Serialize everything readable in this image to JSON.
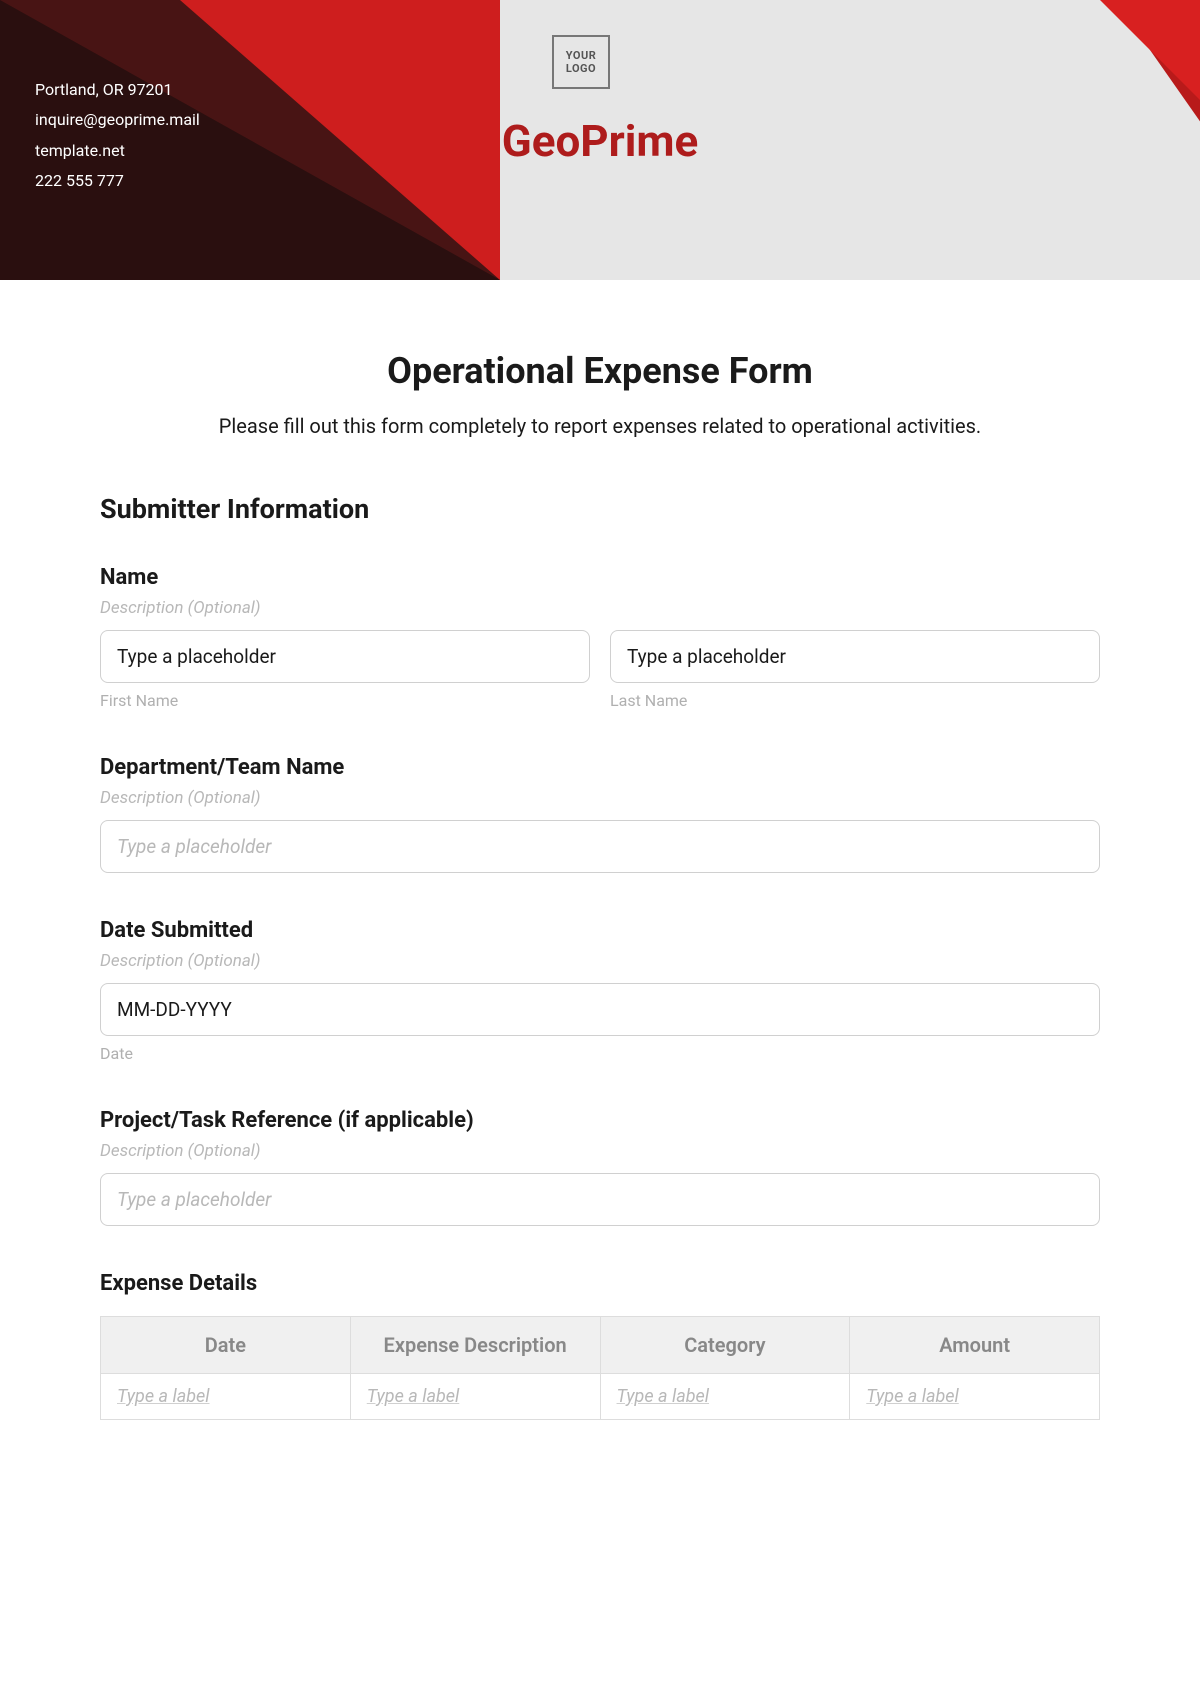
{
  "header": {
    "contact": {
      "address": "Portland, OR 97201",
      "email": "inquire@geoprime.mail",
      "website": "template.net",
      "phone": "222 555 777"
    },
    "logo": "YOUR LOGO",
    "company": "GeoPrime"
  },
  "form": {
    "title": "Operational Expense Form",
    "instruction": "Please fill out this form completely to report expenses related to operational activities.",
    "section1_heading": "Submitter Information",
    "name": {
      "label": "Name",
      "description": "Description (Optional)",
      "first_value": "Type a placeholder",
      "last_value": "Type a placeholder",
      "first_sublabel": "First Name",
      "last_sublabel": "Last Name"
    },
    "department": {
      "label": "Department/Team Name",
      "description": "Description (Optional)",
      "placeholder": "Type a placeholder"
    },
    "date_submitted": {
      "label": "Date Submitted",
      "description": "Description (Optional)",
      "value": "MM-DD-YYYY",
      "sublabel": "Date"
    },
    "project": {
      "label": "Project/Task Reference (if applicable)",
      "description": "Description (Optional)",
      "placeholder": "Type a placeholder"
    },
    "expense_details": {
      "heading": "Expense Details",
      "columns": [
        "Date",
        "Expense Description",
        "Category",
        "Amount"
      ],
      "row_placeholder": "Type a label"
    }
  }
}
